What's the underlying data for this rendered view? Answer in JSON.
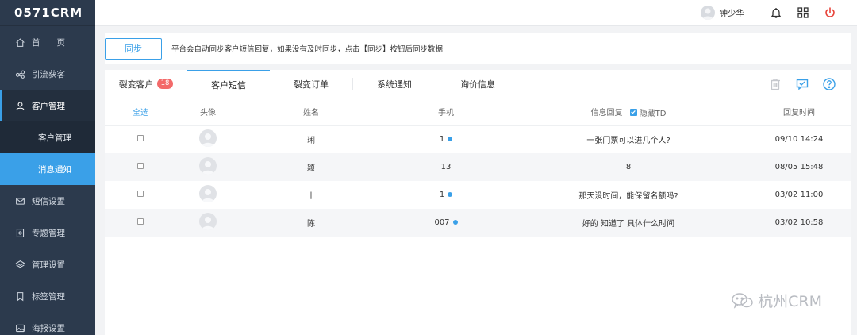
{
  "app": {
    "logo": "0571CRM"
  },
  "sidebar": {
    "items": [
      {
        "label": "首　　页",
        "icon": "home-icon"
      },
      {
        "label": "引流获客",
        "icon": "share-icon"
      },
      {
        "label": "客户管理",
        "icon": "user-icon"
      },
      {
        "label": "短信设置",
        "icon": "mail-icon"
      },
      {
        "label": "专题管理",
        "icon": "book-icon"
      },
      {
        "label": "管理设置",
        "icon": "layers-icon"
      },
      {
        "label": "标签管理",
        "icon": "tag-icon"
      },
      {
        "label": "海报设置",
        "icon": "image-icon"
      }
    ],
    "sub_items": [
      {
        "label": "客户管理"
      },
      {
        "label": "消息通知"
      }
    ]
  },
  "header": {
    "username": "钟少华"
  },
  "sync": {
    "button_label": "同步",
    "note": "平台会自动同步客户短信回复，如果没有及时同步，点击【同步】按钮后同步数据"
  },
  "tabs": [
    {
      "label": "裂变客户",
      "badge": "18"
    },
    {
      "label": "客户短信"
    },
    {
      "label": "裂变订单"
    },
    {
      "label": "系统通知"
    },
    {
      "label": "询价信息"
    }
  ],
  "table": {
    "headers": {
      "select_all": "全选",
      "avatar": "头像",
      "name": "姓名",
      "phone": "手机",
      "reply": "信息回复",
      "hide_td": "隐藏TD",
      "time": "回复时间"
    },
    "rows": [
      {
        "name": "琍",
        "phone": "1",
        "reply": "一张门票可以进几个人?",
        "time": "09/10 14:24"
      },
      {
        "name": "颖",
        "phone": "13",
        "reply": "8",
        "time": "08/05 15:48"
      },
      {
        "name": "丨",
        "phone": "1",
        "reply": "那天没时间，能保留名额吗?",
        "time": "03/02 11:00"
      },
      {
        "name": "陈",
        "phone": "007",
        "reply": "好的 知道了 具体什么时间",
        "time": "03/02 10:58"
      }
    ]
  },
  "watermark": {
    "text": "杭州CRM"
  },
  "colors": {
    "accent": "#3aa0e8",
    "sidebar": "#2c3a4d",
    "badge": "#f36a6a",
    "power": "#e8453c"
  }
}
